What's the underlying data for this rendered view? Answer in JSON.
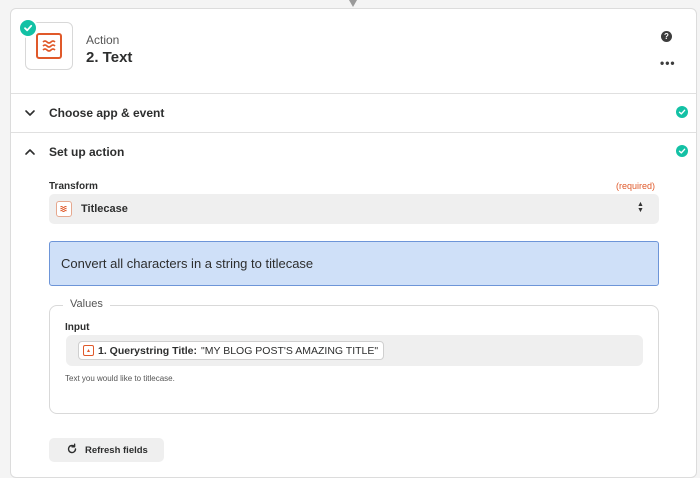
{
  "step": {
    "type_label": "Action",
    "title": "2. Text",
    "app_icon": "formatter-wave-icon",
    "status": "complete",
    "help_glyph": "?",
    "more_glyph": "•••"
  },
  "sections": [
    {
      "label": "Choose app & event",
      "expanded": false,
      "status": "complete"
    },
    {
      "label": "Set up action",
      "expanded": true,
      "status": "complete"
    }
  ],
  "transform": {
    "label": "Transform",
    "required_text": "(required)",
    "selected_value": "Titlecase"
  },
  "info": {
    "text": "Convert all characters in a string to titlecase"
  },
  "values": {
    "legend": "Values",
    "input_label": "Input",
    "token_label": "1. Querystring Title:",
    "token_value": "\"MY BLOG POST'S AMAZING TITLE\"",
    "helper_text": "Text you would like to titlecase."
  },
  "refresh": {
    "label": "Refresh fields"
  },
  "colors": {
    "accent_green": "#13c1a5",
    "brand_orange": "#e0592a",
    "info_bg": "#cfe0f8",
    "info_border": "#6d95d8"
  }
}
